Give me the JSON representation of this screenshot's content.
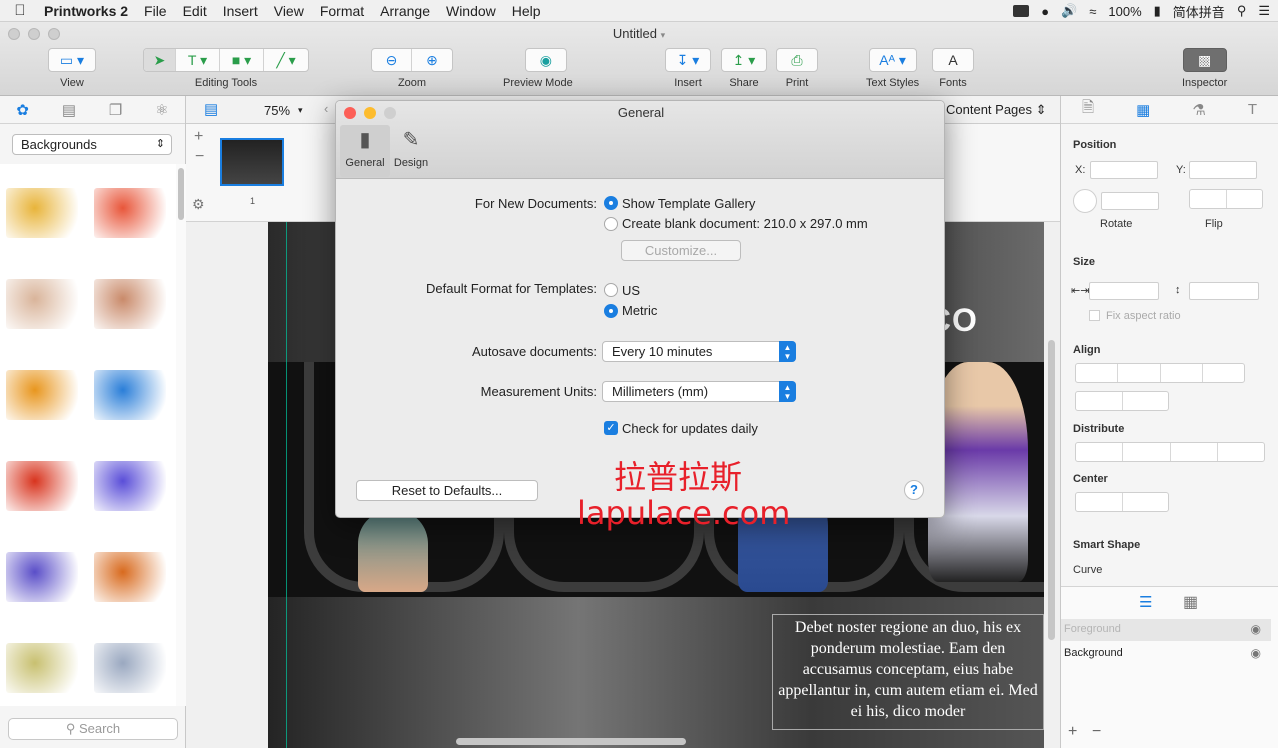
{
  "menubar": {
    "app_name": "Printworks 2",
    "items": [
      "File",
      "Edit",
      "Insert",
      "View",
      "Format",
      "Arrange",
      "Window",
      "Help"
    ],
    "battery": "100%",
    "input_method": "简体拼音"
  },
  "window": {
    "title": "Untitled"
  },
  "toolbar": {
    "view_label": "View",
    "editing_tools_label": "Editing Tools",
    "zoom_label": "Zoom",
    "preview_mode_label": "Preview Mode",
    "insert_label": "Insert",
    "share_label": "Share",
    "print_label": "Print",
    "text_styles_label": "Text Styles",
    "fonts_label": "Fonts",
    "inspector_label": "Inspector"
  },
  "library": {
    "category": "Backgrounds",
    "search_placeholder": "Search",
    "thumbnail_colors": [
      [
        "#e8b43a",
        "#e8563a"
      ],
      [
        "#d9b49a",
        "#c98a6a"
      ],
      [
        "#e8961e",
        "#2a7ed8"
      ],
      [
        "#d8341e",
        "#5a4ed8"
      ],
      [
        "#5a4ec8",
        "#d86a1e"
      ],
      [
        "#c8c070",
        "#9aa8c0"
      ]
    ]
  },
  "canvas": {
    "zoom_value": "75%",
    "content_pages_label": "Content Pages",
    "page_number": "1",
    "banner_text": "NG CO",
    "body_text_lines": [
      "Debet noster regione an duo, his ex",
      "ponderum molestiae. Eam den",
      "accusamus conceptam, eius habe",
      "appellantur in, cum autem etiam ei. Med",
      "ei his, dico moder"
    ]
  },
  "inspector": {
    "position_title": "Position",
    "x_label": "X:",
    "y_label": "Y:",
    "rotate_label": "Rotate",
    "flip_label": "Flip",
    "size_title": "Size",
    "fix_aspect_label": "Fix aspect ratio",
    "align_title": "Align",
    "distribute_title": "Distribute",
    "center_title": "Center",
    "smart_shape_title": "Smart Shape",
    "curve_label": "Curve",
    "layers": [
      {
        "name": "Foreground"
      },
      {
        "name": "Background"
      }
    ],
    "add_layer": "+",
    "remove_layer": "−"
  },
  "prefs": {
    "title": "General",
    "tabs": [
      "General",
      "Design"
    ],
    "new_docs_label": "For New Documents:",
    "show_gallery_label": "Show Template Gallery",
    "blank_doc_label": "Create blank document: 210.0 x 297.0 mm",
    "customize_label": "Customize...",
    "default_format_label": "Default Format for Templates:",
    "format_us": "US",
    "format_metric": "Metric",
    "autosave_label": "Autosave documents:",
    "autosave_value": "Every 10 minutes",
    "units_label": "Measurement Units:",
    "units_value": "Millimeters (mm)",
    "updates_label": "Check for updates daily",
    "reset_label": "Reset to Defaults...",
    "help_symbol": "?"
  },
  "watermark": {
    "line1": "拉普拉斯",
    "line2": "lapulace.com"
  },
  "colors": {
    "accent": "#1a7ee0",
    "close": "#fc5f57",
    "minimize": "#fdbc2e",
    "zoom_disabled": "#cfcfcf",
    "watermark": "#e8202a"
  }
}
